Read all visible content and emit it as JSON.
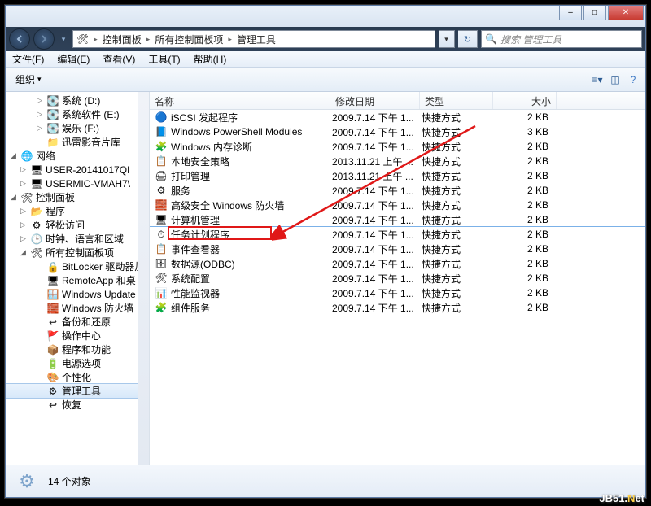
{
  "titlebar": {
    "min": "–",
    "max": "□",
    "close": "✕"
  },
  "nav": {
    "crumbs": [
      "控制面板",
      "所有控制面板项",
      "管理工具"
    ],
    "search_placeholder": "搜索 管理工具"
  },
  "menu": {
    "file": "文件(F)",
    "edit": "编辑(E)",
    "view": "查看(V)",
    "tools": "工具(T)",
    "help": "帮助(H)"
  },
  "toolbar": {
    "organize": "组织"
  },
  "sidebar": {
    "items": [
      {
        "level": 2,
        "icon": "💽",
        "label": "系统 (D:)",
        "exp": "▷"
      },
      {
        "level": 2,
        "icon": "💽",
        "label": "系统软件 (E:)",
        "exp": "▷"
      },
      {
        "level": 2,
        "icon": "💽",
        "label": "娱乐 (F:)",
        "exp": "▷"
      },
      {
        "level": 2,
        "icon": "📁",
        "label": "迅雷影音片库",
        "exp": ""
      },
      {
        "level": 0,
        "icon": "🌐",
        "label": "网络",
        "exp": "◢"
      },
      {
        "level": 1,
        "icon": "🖥",
        "label": "USER-20141017QI",
        "exp": "▷"
      },
      {
        "level": 1,
        "icon": "🖥",
        "label": "USERMIC-VMAH7\\",
        "exp": "▷"
      },
      {
        "level": 0,
        "icon": "🛠",
        "label": "控制面板",
        "exp": "◢"
      },
      {
        "level": 1,
        "icon": "📂",
        "label": "程序",
        "exp": "▷"
      },
      {
        "level": 1,
        "icon": "⚙",
        "label": "轻松访问",
        "exp": "▷"
      },
      {
        "level": 1,
        "icon": "🕒",
        "label": "时钟、语言和区域",
        "exp": "▷"
      },
      {
        "level": 1,
        "icon": "🛠",
        "label": "所有控制面板项",
        "exp": "◢"
      },
      {
        "level": 2,
        "icon": "🔒",
        "label": "BitLocker 驱动器加",
        "exp": ""
      },
      {
        "level": 2,
        "icon": "🖥",
        "label": "RemoteApp 和桌",
        "exp": ""
      },
      {
        "level": 2,
        "icon": "🪟",
        "label": "Windows Update",
        "exp": ""
      },
      {
        "level": 2,
        "icon": "🧱",
        "label": "Windows 防火墙",
        "exp": ""
      },
      {
        "level": 2,
        "icon": "↩",
        "label": "备份和还原",
        "exp": ""
      },
      {
        "level": 2,
        "icon": "🚩",
        "label": "操作中心",
        "exp": ""
      },
      {
        "level": 2,
        "icon": "📦",
        "label": "程序和功能",
        "exp": ""
      },
      {
        "level": 2,
        "icon": "🔋",
        "label": "电源选项",
        "exp": ""
      },
      {
        "level": 2,
        "icon": "🎨",
        "label": "个性化",
        "exp": ""
      },
      {
        "level": 2,
        "icon": "⚙",
        "label": "管理工具",
        "exp": "",
        "sel": true
      },
      {
        "level": 2,
        "icon": "↩",
        "label": "恢复",
        "exp": ""
      }
    ]
  },
  "columns": {
    "name": "名称",
    "date": "修改日期",
    "type": "类型",
    "size": "大小"
  },
  "files": [
    {
      "icon": "🔵",
      "name": "iSCSI 发起程序",
      "date": "2009.7.14 下午 1...",
      "type": "快捷方式",
      "size": "2 KB"
    },
    {
      "icon": "📘",
      "name": "Windows PowerShell Modules",
      "date": "2009.7.14 下午 1...",
      "type": "快捷方式",
      "size": "3 KB"
    },
    {
      "icon": "🧩",
      "name": "Windows 内存诊断",
      "date": "2009.7.14 下午 1...",
      "type": "快捷方式",
      "size": "2 KB"
    },
    {
      "icon": "📋",
      "name": "本地安全策略",
      "date": "2013.11.21 上午 ...",
      "type": "快捷方式",
      "size": "2 KB"
    },
    {
      "icon": "🖨",
      "name": "打印管理",
      "date": "2013.11.21 上午 ...",
      "type": "快捷方式",
      "size": "2 KB"
    },
    {
      "icon": "⚙",
      "name": "服务",
      "date": "2009.7.14 下午 1...",
      "type": "快捷方式",
      "size": "2 KB"
    },
    {
      "icon": "🧱",
      "name": "高级安全 Windows 防火墙",
      "date": "2009.7.14 下午 1...",
      "type": "快捷方式",
      "size": "2 KB"
    },
    {
      "icon": "🖥",
      "name": "计算机管理",
      "date": "2009.7.14 下午 1...",
      "type": "快捷方式",
      "size": "2 KB"
    },
    {
      "icon": "⏱",
      "name": "任务计划程序",
      "date": "2009.7.14 下午 1...",
      "type": "快捷方式",
      "size": "2 KB",
      "sel": true
    },
    {
      "icon": "📋",
      "name": "事件查看器",
      "date": "2009.7.14 下午 1...",
      "type": "快捷方式",
      "size": "2 KB"
    },
    {
      "icon": "🗄",
      "name": "数据源(ODBC)",
      "date": "2009.7.14 下午 1...",
      "type": "快捷方式",
      "size": "2 KB"
    },
    {
      "icon": "🛠",
      "name": "系统配置",
      "date": "2009.7.14 下午 1...",
      "type": "快捷方式",
      "size": "2 KB"
    },
    {
      "icon": "📊",
      "name": "性能监视器",
      "date": "2009.7.14 下午 1...",
      "type": "快捷方式",
      "size": "2 KB"
    },
    {
      "icon": "🧩",
      "name": "组件服务",
      "date": "2009.7.14 下午 1...",
      "type": "快捷方式",
      "size": "2 KB"
    }
  ],
  "status": {
    "text": "14 个对象"
  },
  "watermark": {
    "a": "JB51.",
    "b": "N",
    "c": "et"
  },
  "highlight_index": 8,
  "arrow_from": 0
}
